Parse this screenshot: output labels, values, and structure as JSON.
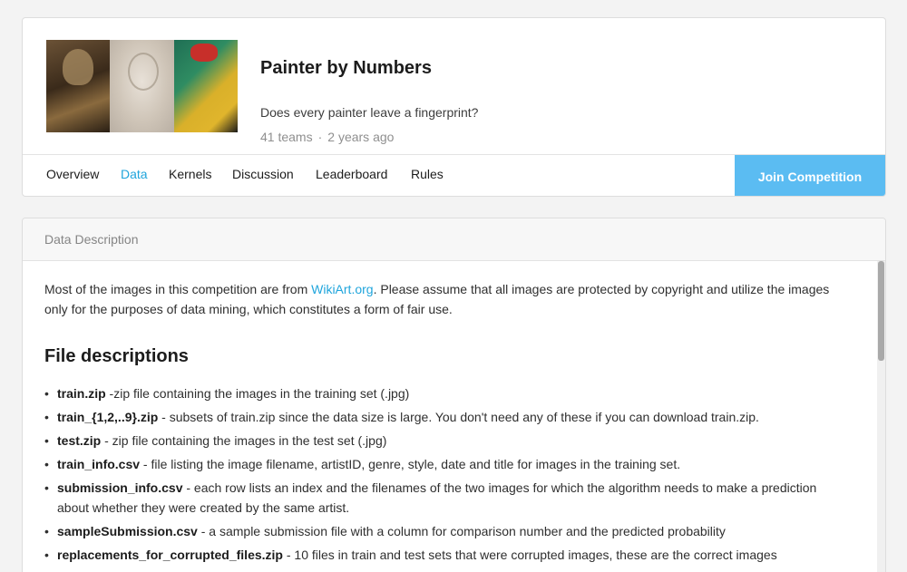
{
  "competition": {
    "title": "Painter by Numbers",
    "subtitle": "Does every painter leave a fingerprint?",
    "teams": "41 teams",
    "separator": "·",
    "age": "2 years ago"
  },
  "tabs": [
    "Overview",
    "Data",
    "Kernels",
    "Discussion",
    "Leaderboard",
    "Rules"
  ],
  "active_tab": "Data",
  "join_button": "Join Competition",
  "data_section": {
    "header": "Data Description",
    "intro_before": "Most of the images in this competition are from ",
    "intro_link": "WikiArt.org",
    "intro_after": ". Please assume that all images are protected by copyright and utilize the images only for the purposes of data mining, which constitutes a form of fair use.",
    "files_heading": "File descriptions",
    "files": [
      {
        "name": "train.zip",
        "desc": " -zip file containing the images in the training set (.jpg)"
      },
      {
        "name": "train_{1,2,..9}.zip",
        "desc": " - subsets of train.zip since the data size is large. You don't need any of these if you can download train.zip."
      },
      {
        "name": "test.zip",
        "desc": " - zip file containing the images in the test set (.jpg)"
      },
      {
        "name": "train_info.csv",
        "desc": " - file listing the image filename, artistID, genre, style, date and title for images in the training set."
      },
      {
        "name": "submission_info.csv",
        "desc": " - each row lists an index and the filenames of the two images for which the algorithm needs to make a prediction about whether they were created by the same artist."
      },
      {
        "name": "sampleSubmission.csv",
        "desc": " - a sample submission file with a column for comparison number and the predicted probability"
      },
      {
        "name": "replacements_for_corrupted_files.zip",
        "desc": " - 10 files in train and test sets that were corrupted images, these are the correct images"
      }
    ]
  },
  "colors": {
    "accent": "#20a5dc",
    "join_button": "#5bbcf2"
  }
}
